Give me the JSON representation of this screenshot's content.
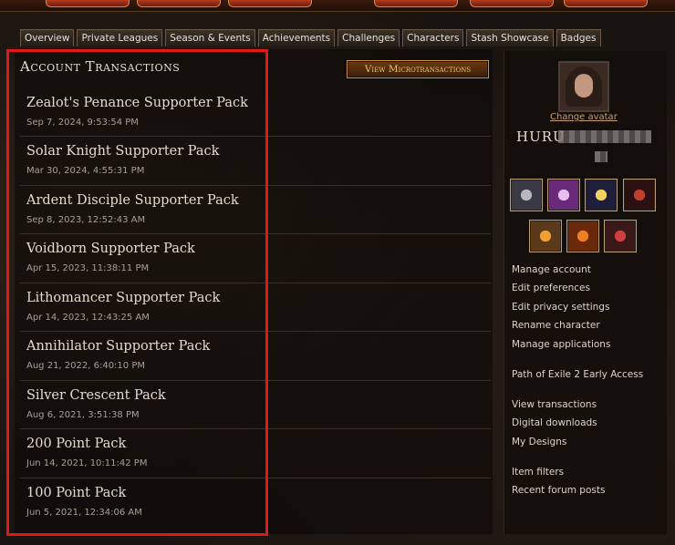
{
  "tabs": [
    {
      "label": "Overview"
    },
    {
      "label": "Private Leagues"
    },
    {
      "label": "Season & Events"
    },
    {
      "label": "Achievements"
    },
    {
      "label": "Challenges"
    },
    {
      "label": "Characters"
    },
    {
      "label": "Stash Showcase"
    },
    {
      "label": "Badges"
    }
  ],
  "main": {
    "title": "Account Transactions",
    "mtx_button": "View Microtransactions",
    "transactions": [
      {
        "name": "Zealot's Penance Supporter Pack",
        "date": "Sep 7, 2024, 9:53:54 PM"
      },
      {
        "name": "Solar Knight Supporter Pack",
        "date": "Mar 30, 2024, 4:55:31 PM"
      },
      {
        "name": "Ardent Disciple Supporter Pack",
        "date": "Sep 8, 2023, 12:52:43 AM"
      },
      {
        "name": "Voidborn Supporter Pack",
        "date": "Apr 15, 2023, 11:38:11 PM"
      },
      {
        "name": "Lithomancer Supporter Pack",
        "date": "Apr 14, 2023, 12:43:25 AM"
      },
      {
        "name": "Annihilator Supporter Pack",
        "date": "Aug 21, 2022, 6:40:10 PM"
      },
      {
        "name": "Silver Crescent Pack",
        "date": "Aug 6, 2021, 3:51:38 PM"
      },
      {
        "name": "200 Point Pack",
        "date": "Jun 14, 2021, 10:11:42 PM"
      },
      {
        "name": "100 Point Pack",
        "date": "Jun 5, 2021, 12:34:06 AM"
      }
    ]
  },
  "sidebar": {
    "change_avatar": "Change avatar",
    "username": "HURU",
    "links": [
      {
        "label": "Manage account"
      },
      {
        "label": "Edit preferences"
      },
      {
        "label": "Edit privacy settings"
      },
      {
        "label": "Rename character"
      },
      {
        "label": "Manage applications"
      },
      {
        "label": "Path of Exile 2 Early Access"
      },
      {
        "label": "View transactions"
      },
      {
        "label": "Digital downloads"
      },
      {
        "label": "My Designs"
      },
      {
        "label": "Item filters"
      },
      {
        "label": "Recent forum posts"
      }
    ]
  },
  "colors": {
    "highlight": "#e01818",
    "button_text": "#f0c070",
    "link": "#c9a070"
  }
}
